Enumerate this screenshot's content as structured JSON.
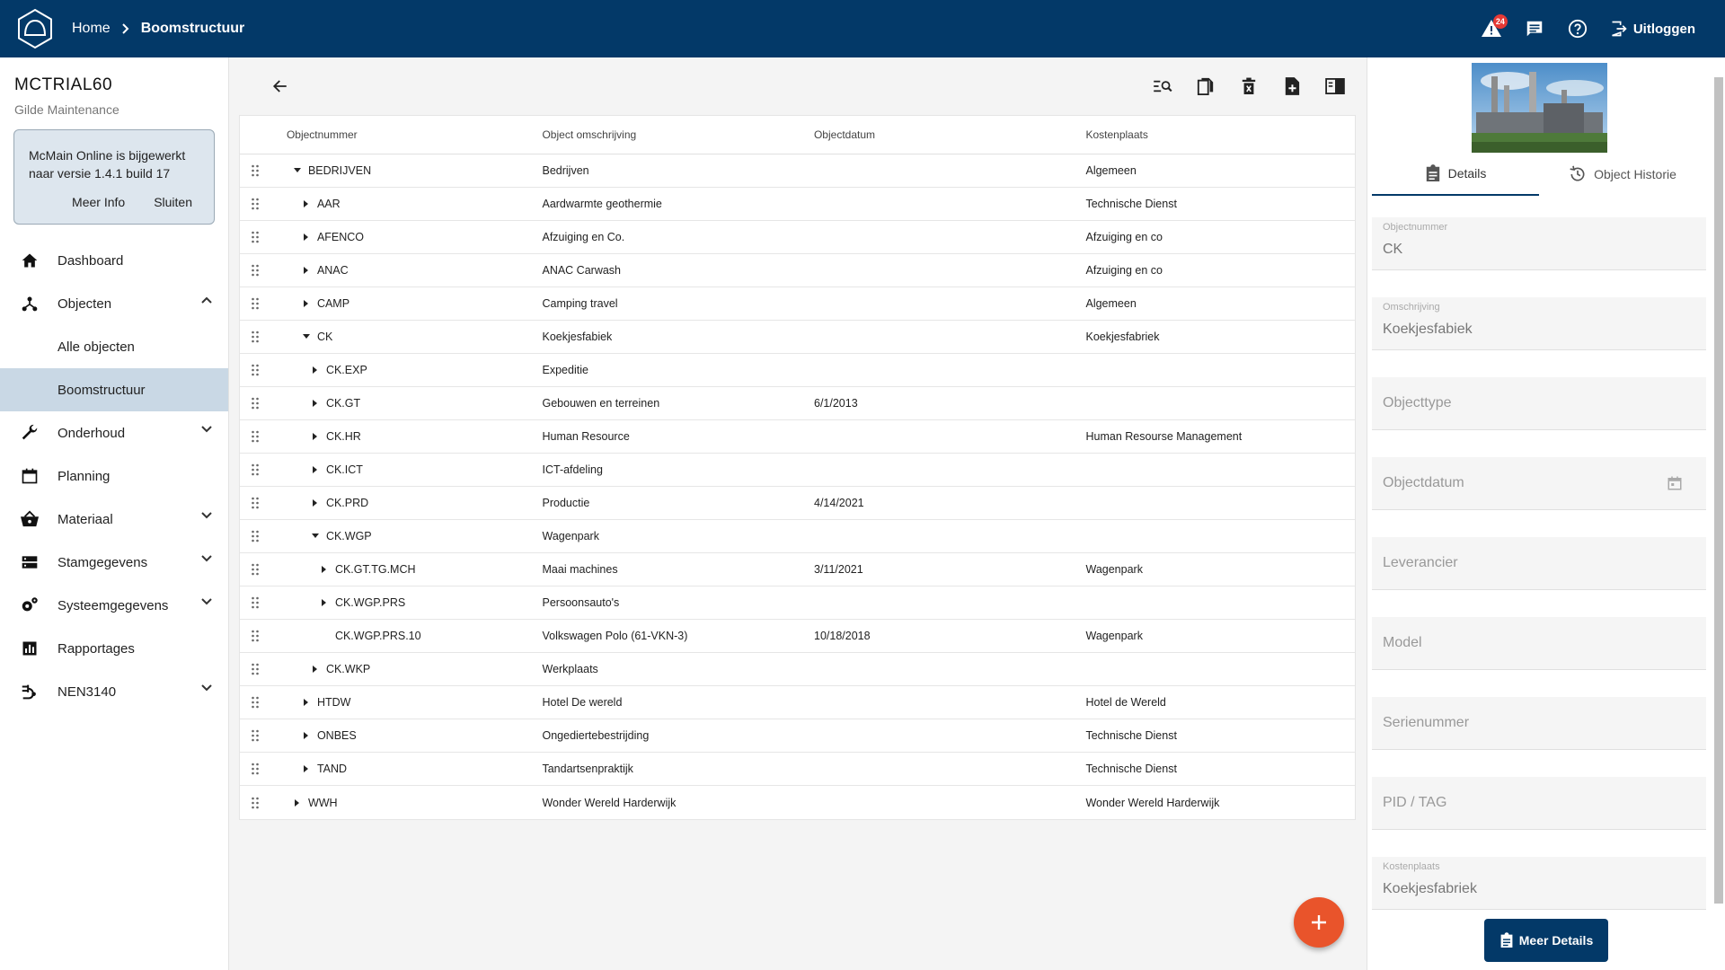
{
  "header": {
    "breadcrumb_home": "Home",
    "breadcrumb_current": "Boomstructuur",
    "alert_count": "24",
    "logout_label": "Uitloggen",
    "bg_color": "#033968"
  },
  "sidebar": {
    "tenant_code": "MCTRIAL60",
    "tenant_name": "Gilde Maintenance",
    "notice": {
      "text": "McMain Online is bijgewerkt naar versie 1.4.1 build 17",
      "more_info": "Meer Info",
      "close": "Sluiten"
    },
    "items": [
      {
        "label": "Dashboard",
        "icon": "home-icon"
      },
      {
        "label": "Objecten",
        "icon": "hierarchy-icon",
        "expanded": true,
        "children": [
          {
            "label": "Alle objecten"
          },
          {
            "label": "Boomstructuur",
            "active": true
          }
        ]
      },
      {
        "label": "Onderhoud",
        "icon": "wrench-icon"
      },
      {
        "label": "Planning",
        "icon": "calendar-icon"
      },
      {
        "label": "Materiaal",
        "icon": "basket-icon"
      },
      {
        "label": "Stamgegevens",
        "icon": "storage-icon"
      },
      {
        "label": "Systeemgegevens",
        "icon": "settings-cog-icon"
      },
      {
        "label": "Rapportages",
        "icon": "bar-chart-icon"
      },
      {
        "label": "NEN3140",
        "icon": "electrical-icon"
      }
    ]
  },
  "grid": {
    "columns": [
      "Objectnummer",
      "Object omschrijving",
      "Objectdatum",
      "Kostenplaats"
    ],
    "rows": [
      {
        "level": 0,
        "toggle": "open",
        "num": "BEDRIJVEN",
        "desc": "Bedrijven",
        "date": "",
        "cost": "Algemeen"
      },
      {
        "level": 1,
        "toggle": "closed",
        "num": "AAR",
        "desc": "Aardwarmte geothermie",
        "date": "",
        "cost": "Technische Dienst"
      },
      {
        "level": 1,
        "toggle": "closed",
        "num": "AFENCO",
        "desc": "Afzuiging en Co.",
        "date": "",
        "cost": "Afzuiging en co"
      },
      {
        "level": 1,
        "toggle": "closed",
        "num": "ANAC",
        "desc": "ANAC Carwash",
        "date": "",
        "cost": "Afzuiging en co"
      },
      {
        "level": 1,
        "toggle": "closed",
        "num": "CAMP",
        "desc": "Camping travel",
        "date": "",
        "cost": "Algemeen"
      },
      {
        "level": 1,
        "toggle": "open",
        "num": "CK",
        "desc": "Koekjesfabiek",
        "date": "",
        "cost": "Koekjesfabriek"
      },
      {
        "level": 2,
        "toggle": "closed",
        "num": "CK.EXP",
        "desc": "Expeditie",
        "date": "",
        "cost": ""
      },
      {
        "level": 2,
        "toggle": "closed",
        "num": "CK.GT",
        "desc": "Gebouwen en terreinen",
        "date": "6/1/2013",
        "cost": ""
      },
      {
        "level": 2,
        "toggle": "closed",
        "num": "CK.HR",
        "desc": "Human Resource",
        "date": "",
        "cost": "Human Resourse Management"
      },
      {
        "level": 2,
        "toggle": "closed",
        "num": "CK.ICT",
        "desc": "ICT-afdeling",
        "date": "",
        "cost": ""
      },
      {
        "level": 2,
        "toggle": "closed",
        "num": "CK.PRD",
        "desc": "Productie",
        "date": "4/14/2021",
        "cost": ""
      },
      {
        "level": 2,
        "toggle": "open",
        "num": "CK.WGP",
        "desc": "Wagenpark",
        "date": "",
        "cost": ""
      },
      {
        "level": 3,
        "toggle": "closed",
        "num": "CK.GT.TG.MCH",
        "desc": "Maai machines",
        "date": "3/11/2021",
        "cost": "Wagenpark"
      },
      {
        "level": 3,
        "toggle": "closed",
        "num": "CK.WGP.PRS",
        "desc": "Persoonsauto's",
        "date": "",
        "cost": ""
      },
      {
        "level": 3,
        "toggle": "none",
        "num": "CK.WGP.PRS.10",
        "desc": "Volkswagen Polo (61-VKN-3)",
        "date": "10/18/2018",
        "cost": "Wagenpark"
      },
      {
        "level": 2,
        "toggle": "closed",
        "num": "CK.WKP",
        "desc": "Werkplaats",
        "date": "",
        "cost": ""
      },
      {
        "level": 1,
        "toggle": "closed",
        "num": "HTDW",
        "desc": "Hotel De wereld",
        "date": "",
        "cost": "Hotel de Wereld"
      },
      {
        "level": 1,
        "toggle": "closed",
        "num": "ONBES",
        "desc": "Ongediertebestrijding",
        "date": "",
        "cost": "Technische Dienst"
      },
      {
        "level": 1,
        "toggle": "closed",
        "num": "TAND",
        "desc": "Tandartsenpraktijk",
        "date": "",
        "cost": "Technische Dienst"
      },
      {
        "level": 0,
        "toggle": "closed",
        "num": "WWH",
        "desc": "Wonder Wereld Harderwijk",
        "date": "",
        "cost": "Wonder Wereld Harderwijk"
      }
    ]
  },
  "details": {
    "tabs": [
      {
        "label": "Details",
        "active": true
      },
      {
        "label": "Object Historie"
      }
    ],
    "fields": [
      {
        "label": "Objectnummer",
        "value": "CK"
      },
      {
        "label": "Omschrijving",
        "value": "Koekjesfabiek"
      },
      {
        "label": "",
        "placeholder": "Objecttype"
      },
      {
        "label": "",
        "placeholder": "Objectdatum",
        "calendar": true
      },
      {
        "label": "",
        "placeholder": "Leverancier"
      },
      {
        "label": "",
        "placeholder": "Model"
      },
      {
        "label": "",
        "placeholder": "Serienummer"
      },
      {
        "label": "",
        "placeholder": "PID / TAG"
      },
      {
        "label": "Kostenplaats",
        "value": "Koekjesfabriek"
      }
    ],
    "more_details": "Meer Details"
  },
  "colors": {
    "primary": "#033968",
    "fab": "#e9542b",
    "active_nav": "#c9d8e5"
  }
}
